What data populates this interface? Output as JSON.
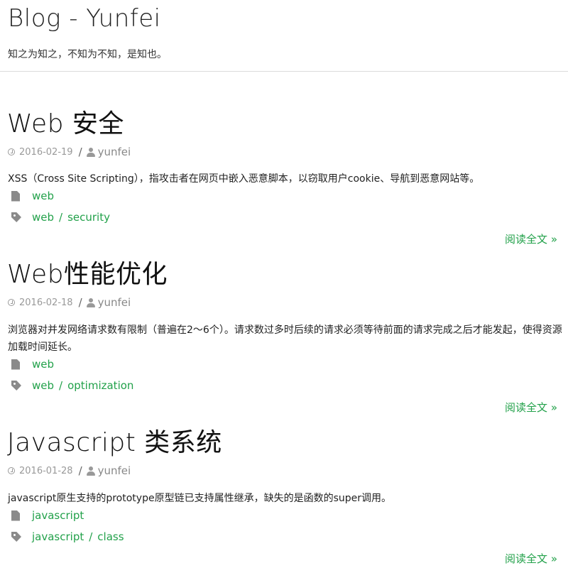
{
  "site": {
    "title": "Blog - Yunfei",
    "subtitle": "知之为知之，不知为不知，是知也。"
  },
  "meta_separator": "/",
  "tag_separator": "/",
  "read_more_label": "阅读全文 »",
  "icons": {
    "date": "clock-icon",
    "author": "user-icon",
    "category": "file-icon",
    "tags": "tag-icon"
  },
  "colors": {
    "link": "#22a14a",
    "text": "#222222",
    "muted": "#999999"
  },
  "posts": [
    {
      "title": "Web 安全",
      "date": "2016-02-19",
      "author": "yunfei",
      "excerpt": "XSS（Cross Site Scripting），指攻击者在网页中嵌入恶意脚本，以窃取用户cookie、导航到恶意网站等。",
      "category": "web",
      "tags": [
        "web",
        "security"
      ]
    },
    {
      "title": "Web性能优化",
      "date": "2016-02-18",
      "author": "yunfei",
      "excerpt": "浏览器对并发网络请求数有限制（普遍在2～6个）。请求数过多时后续的请求必须等待前面的请求完成之后才能发起，使得资源加载时间延长。",
      "category": "web",
      "tags": [
        "web",
        "optimization"
      ]
    },
    {
      "title": "Javascript 类系统",
      "date": "2016-01-28",
      "author": "yunfei",
      "excerpt": "javascript原生支持的prototype原型链已支持属性继承，缺失的是函数的super调用。",
      "category": "javascript",
      "tags": [
        "javascript",
        "class"
      ]
    }
  ]
}
